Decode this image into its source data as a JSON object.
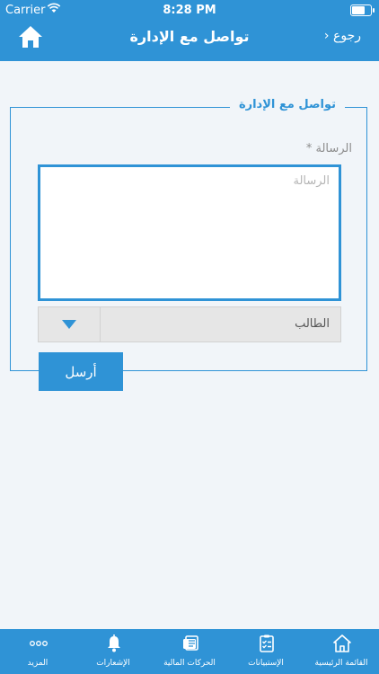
{
  "status_bar": {
    "carrier": "Carrier",
    "time": "8:28 PM",
    "battery_level": 0.85
  },
  "header": {
    "title": "تواصل مع الإدارة",
    "back_label": "رجوع"
  },
  "form": {
    "section_title": "تواصل مع الإدارة",
    "message_label": "الرسالة",
    "required_mark": "*",
    "message_placeholder": "الرسالة",
    "message_value": "",
    "recipient_selected": "الطالب",
    "submit_label": "أرسل"
  },
  "tabbar": {
    "items": [
      {
        "label": "القائمة الرئيسية",
        "icon": "home-icon"
      },
      {
        "label": "الإستبيانات",
        "icon": "survey-icon"
      },
      {
        "label": "الحركات المالية",
        "icon": "payments-icon"
      },
      {
        "label": "الإشعارات",
        "icon": "bell-icon"
      },
      {
        "label": "المزيد",
        "icon": "more-icon"
      }
    ]
  },
  "colors": {
    "primary": "#2f93d6",
    "background": "#f1f5f9"
  }
}
